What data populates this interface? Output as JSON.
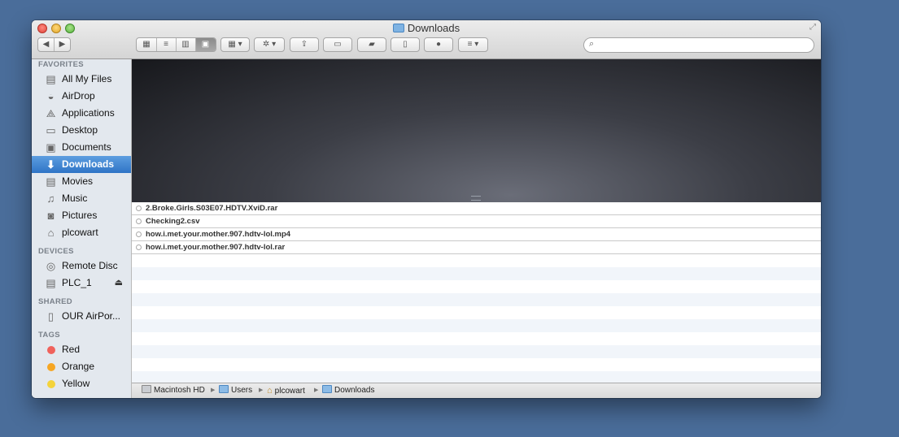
{
  "window": {
    "title": "Downloads"
  },
  "toolbar": {
    "back_glyph": "◀",
    "forward_glyph": "▶",
    "view_icons": [
      "icon-view",
      "list-view",
      "column-view",
      "coverflow-view"
    ],
    "search": {
      "value": "",
      "placeholder": ""
    }
  },
  "sidebar": {
    "favorites_header": "FAVORITES",
    "favorites": [
      {
        "label": "All My Files",
        "icon": "all-files-icon"
      },
      {
        "label": "AirDrop",
        "icon": "airdrop-icon"
      },
      {
        "label": "Applications",
        "icon": "applications-icon"
      },
      {
        "label": "Desktop",
        "icon": "desktop-icon"
      },
      {
        "label": "Documents",
        "icon": "documents-icon"
      },
      {
        "label": "Downloads",
        "icon": "downloads-icon",
        "selected": true
      },
      {
        "label": "Movies",
        "icon": "movies-icon"
      },
      {
        "label": "Music",
        "icon": "music-icon"
      },
      {
        "label": "Pictures",
        "icon": "pictures-icon"
      },
      {
        "label": "plcowart",
        "icon": "home-icon"
      }
    ],
    "devices_header": "DEVICES",
    "devices": [
      {
        "label": "Remote Disc",
        "icon": "disc-icon"
      },
      {
        "label": "PLC_1",
        "icon": "drive-icon"
      }
    ],
    "shared_header": "SHARED",
    "shared": [
      {
        "label": "OUR AirPor...",
        "icon": "airport-icon"
      }
    ],
    "tags_header": "TAGS",
    "tags": [
      {
        "label": "Red",
        "color": "#f0625c"
      },
      {
        "label": "Orange",
        "color": "#f6a623"
      },
      {
        "label": "Yellow",
        "color": "#f4d33b"
      }
    ]
  },
  "files": [
    "2.Broke.Girls.S03E07.HDTV.XviD.rar",
    "Checking2.csv",
    "how.i.met.your.mother.907.hdtv-lol.mp4",
    "how.i.met.your.mother.907.hdtv-lol.rar"
  ],
  "pathbar": {
    "items": [
      "Macintosh HD",
      "Users",
      "plcowart",
      "Downloads"
    ],
    "separator": "▶"
  }
}
